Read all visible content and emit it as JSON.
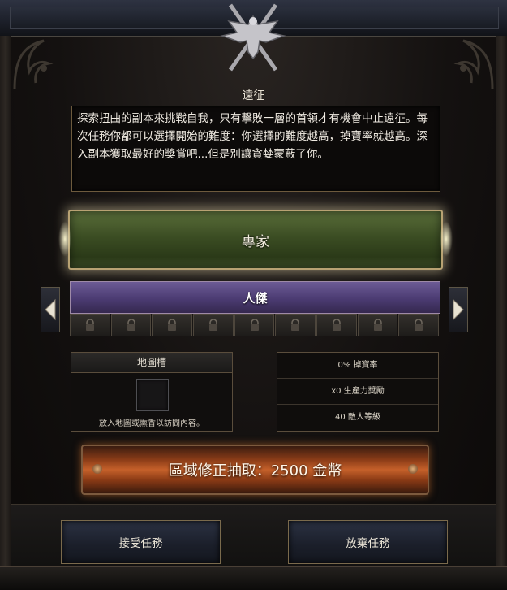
{
  "window": {
    "title": "遠征"
  },
  "description": "探索扭曲的副本來挑戰自我，只有擊敗一層的首領才有機會中止遠征。每次任務你都可以選擇開始的難度：你選擇的難度越高，掉寶率就越高。深入副本獲取最好的獎賞吧...但是別讓貪婪蒙蔽了你。",
  "difficulty": {
    "selected_label": "專家",
    "next_label": "人傑",
    "locked_slots": 9
  },
  "map_slot": {
    "header": "地圖槽",
    "note": "放入地圖或熏香以訪問內容。"
  },
  "stats": {
    "drop_rate": "0% 掉寶率",
    "productivity": "x0 生產力獎勵",
    "enemy_level": "40 敵人等級"
  },
  "modifier_button": {
    "label": "區域修正抽取：2500 金幣"
  },
  "actions": {
    "accept": "接受任務",
    "abandon": "放棄任務"
  },
  "colors": {
    "expert_green": "#3b4d23",
    "hero_purple": "#4b3b72",
    "modifier_orange": "#c5602a",
    "frame_gold": "#b8a273"
  },
  "icons": [
    "eagle-emblem-icon",
    "sword-icon",
    "arrow-left-icon",
    "arrow-right-icon",
    "lock-icon"
  ]
}
